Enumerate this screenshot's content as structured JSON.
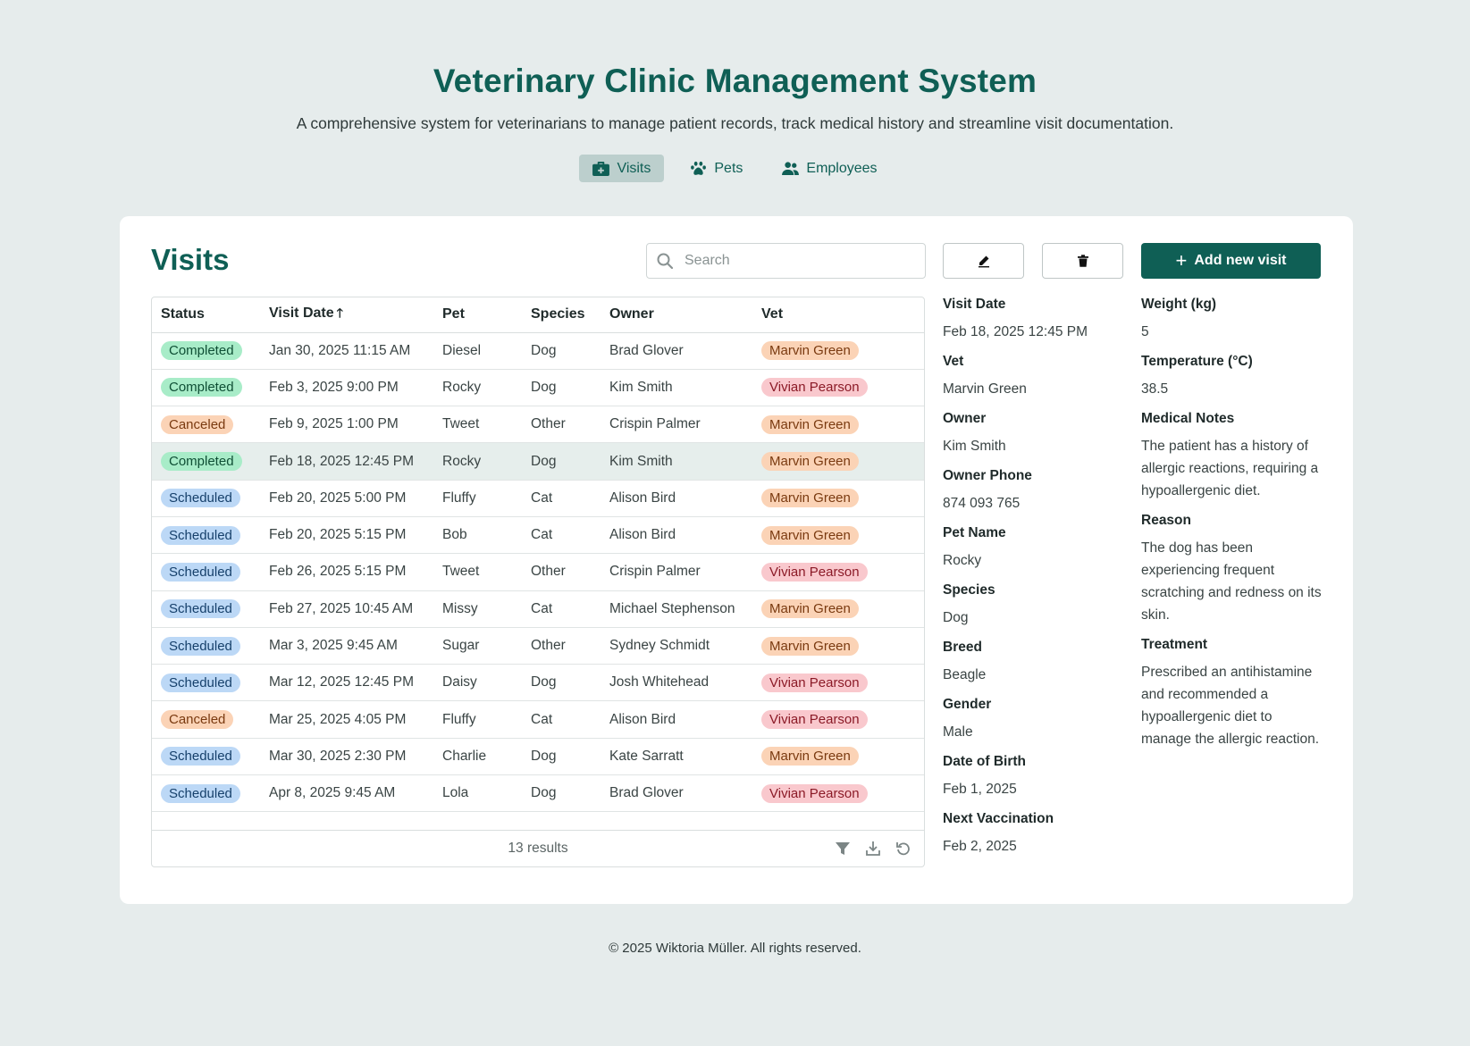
{
  "header": {
    "title": "Veterinary Clinic Management System",
    "subtitle": "A comprehensive system for veterinarians to manage patient records, track medical history and streamline visit documentation."
  },
  "nav": [
    {
      "label": "Visits",
      "icon": "medical-kit-icon",
      "active": true
    },
    {
      "label": "Pets",
      "icon": "paw-icon",
      "active": false
    },
    {
      "label": "Employees",
      "icon": "users-icon",
      "active": false
    }
  ],
  "page": {
    "title": "Visits",
    "search_placeholder": "Search",
    "add_button": "Add new visit",
    "accent_color": "#0f5f55"
  },
  "table": {
    "columns": [
      "Status",
      "Visit Date",
      "Pet",
      "Species",
      "Owner",
      "Vet"
    ],
    "sort_column": "Visit Date",
    "sort_direction": "ascending",
    "selected_row": 3,
    "rows": [
      {
        "status": "Completed",
        "date": "Jan 30, 2025 11:15 AM",
        "pet": "Diesel",
        "species": "Dog",
        "owner": "Brad Glover",
        "vet": "Marvin Green"
      },
      {
        "status": "Completed",
        "date": "Feb 3, 2025 9:00 PM",
        "pet": "Rocky",
        "species": "Dog",
        "owner": "Kim Smith",
        "vet": "Vivian Pearson"
      },
      {
        "status": "Canceled",
        "date": "Feb 9, 2025 1:00 PM",
        "pet": "Tweet",
        "species": "Other",
        "owner": "Crispin Palmer",
        "vet": "Marvin Green"
      },
      {
        "status": "Completed",
        "date": "Feb 18, 2025 12:45 PM",
        "pet": "Rocky",
        "species": "Dog",
        "owner": "Kim Smith",
        "vet": "Marvin Green"
      },
      {
        "status": "Scheduled",
        "date": "Feb 20, 2025 5:00 PM",
        "pet": "Fluffy",
        "species": "Cat",
        "owner": "Alison Bird",
        "vet": "Marvin Green"
      },
      {
        "status": "Scheduled",
        "date": "Feb 20, 2025 5:15 PM",
        "pet": "Bob",
        "species": "Cat",
        "owner": "Alison Bird",
        "vet": "Marvin Green"
      },
      {
        "status": "Scheduled",
        "date": "Feb 26, 2025 5:15 PM",
        "pet": "Tweet",
        "species": "Other",
        "owner": "Crispin Palmer",
        "vet": "Vivian Pearson"
      },
      {
        "status": "Scheduled",
        "date": "Feb 27, 2025 10:45 AM",
        "pet": "Missy",
        "species": "Cat",
        "owner": "Michael Stephenson",
        "vet": "Marvin Green"
      },
      {
        "status": "Scheduled",
        "date": "Mar 3, 2025 9:45 AM",
        "pet": "Sugar",
        "species": "Other",
        "owner": "Sydney Schmidt",
        "vet": "Marvin Green"
      },
      {
        "status": "Scheduled",
        "date": "Mar 12, 2025 12:45 PM",
        "pet": "Daisy",
        "species": "Dog",
        "owner": "Josh Whitehead",
        "vet": "Vivian Pearson"
      },
      {
        "status": "Canceled",
        "date": "Mar 25, 2025 4:05 PM",
        "pet": "Fluffy",
        "species": "Cat",
        "owner": "Alison Bird",
        "vet": "Vivian Pearson"
      },
      {
        "status": "Scheduled",
        "date": "Mar 30, 2025 2:30 PM",
        "pet": "Charlie",
        "species": "Dog",
        "owner": "Kate Sarratt",
        "vet": "Marvin Green"
      },
      {
        "status": "Scheduled",
        "date": "Apr 8, 2025 9:45 AM",
        "pet": "Lola",
        "species": "Dog",
        "owner": "Brad Glover",
        "vet": "Vivian Pearson"
      }
    ],
    "results_text": "13 results",
    "footer_icons": [
      "filter-icon",
      "download-icon",
      "reset-icon"
    ]
  },
  "details": {
    "col1": [
      {
        "label": "Visit Date",
        "value": "Feb 18, 2025 12:45 PM"
      },
      {
        "label": "Vet",
        "value": "Marvin Green"
      },
      {
        "label": "Owner",
        "value": "Kim Smith"
      },
      {
        "label": "Owner Phone",
        "value": "874 093 765"
      },
      {
        "label": "Pet Name",
        "value": "Rocky"
      },
      {
        "label": "Species",
        "value": "Dog"
      },
      {
        "label": "Breed",
        "value": "Beagle"
      },
      {
        "label": "Gender",
        "value": "Male"
      },
      {
        "label": "Date of Birth",
        "value": "Feb 1, 2025"
      },
      {
        "label": "Next Vaccination",
        "value": "Feb 2, 2025"
      }
    ],
    "col2": [
      {
        "label": "Weight (kg)",
        "value": "5"
      },
      {
        "label": "Temperature (°C)",
        "value": "38.5"
      },
      {
        "label": "Medical Notes",
        "value": "The patient has a history of allergic reactions, requiring a hypoallergenic diet."
      },
      {
        "label": "Reason",
        "value": "The dog has been experiencing frequent scratching and redness on its skin."
      },
      {
        "label": "Treatment",
        "value": "Prescribed an antihistamine and recommended a hypoallergenic diet to manage the allergic reaction."
      }
    ]
  },
  "footer": {
    "copyright": "© 2025 Wiktoria Müller. All rights reserved."
  }
}
